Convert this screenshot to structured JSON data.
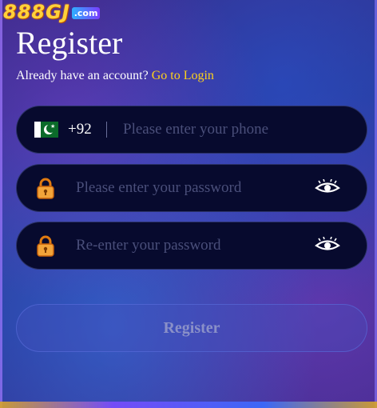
{
  "logo": {
    "main": "888GJ",
    "suffix": ".com"
  },
  "title": "Register",
  "subtitle": {
    "text": "Already have an account?",
    "link": "Go to Login"
  },
  "phone": {
    "country_flag": "pakistan-flag-icon",
    "code": "+92",
    "placeholder": "Please enter your phone",
    "value": ""
  },
  "password": {
    "placeholder": "Please enter your password",
    "value": "",
    "icon": "lock-icon",
    "toggle_icon": "eye-icon"
  },
  "confirm_password": {
    "placeholder": "Re-enter your password",
    "value": "",
    "icon": "lock-icon",
    "toggle_icon": "eye-icon"
  },
  "submit": {
    "label": "Register"
  },
  "colors": {
    "link": "#ffd21a",
    "field_bg": "#070a2e",
    "placeholder": "#4a4f7a",
    "button_text": "#8a90c8"
  }
}
